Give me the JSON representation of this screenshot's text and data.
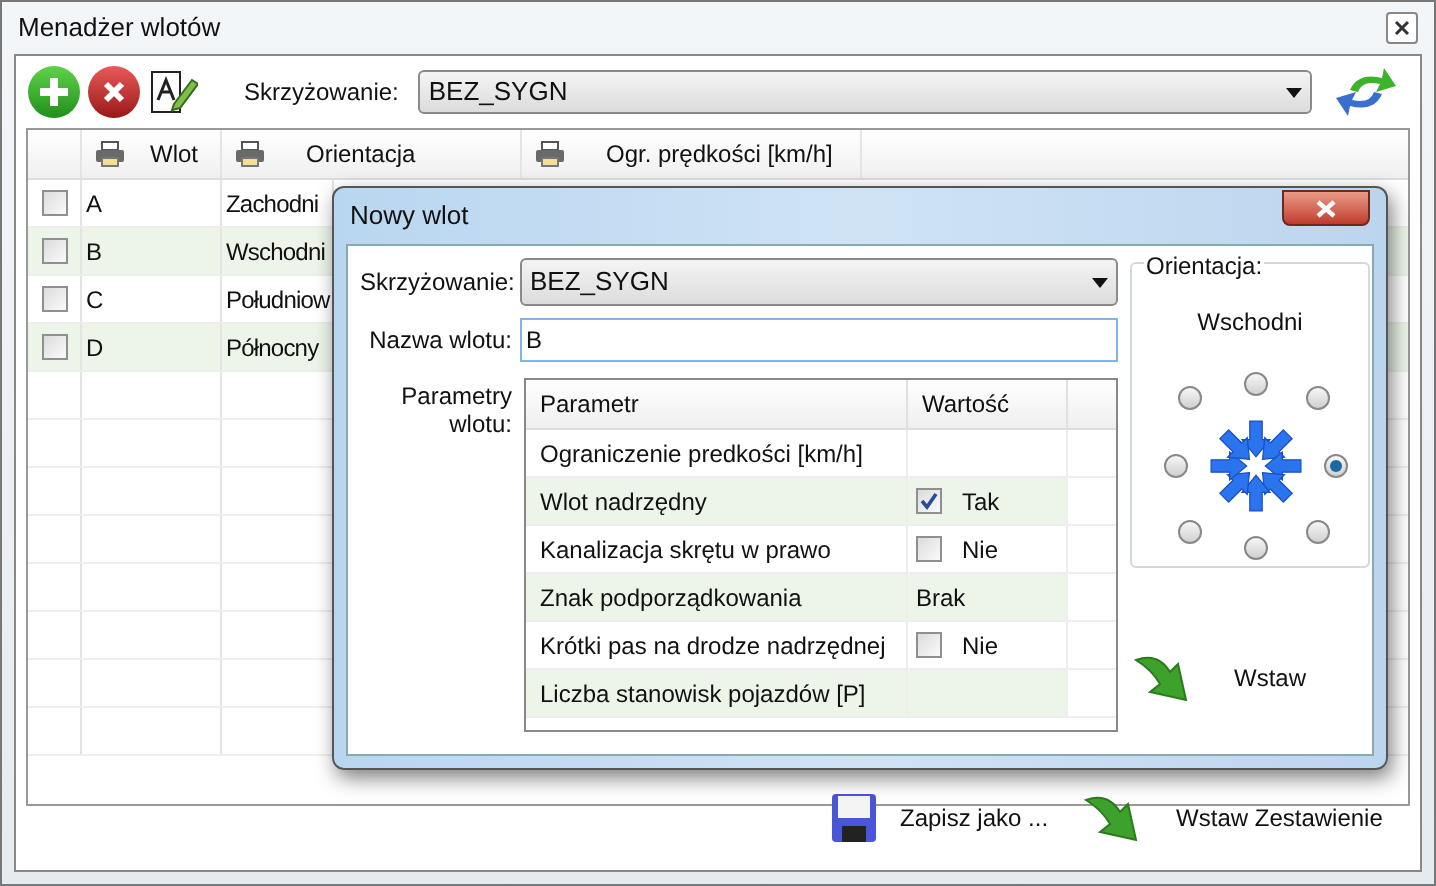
{
  "window": {
    "title": "Menadżer wlotów"
  },
  "toolbar": {
    "intersection_label": "Skrzyżowanie:",
    "intersection_value": "BEZ_SYGN"
  },
  "table": {
    "columns": [
      "Wlot",
      "Orientacja",
      "Ogr. prędkości [km/h]"
    ],
    "rows": [
      {
        "checked": false,
        "cells": [
          "A",
          "Zachodni"
        ]
      },
      {
        "checked": false,
        "cells": [
          "B",
          "Wschodni"
        ]
      },
      {
        "checked": false,
        "cells": [
          "C",
          "Południow"
        ]
      },
      {
        "checked": false,
        "cells": [
          "D",
          "Północny"
        ]
      }
    ]
  },
  "dialog": {
    "title": "Nowy wlot",
    "intersection_label": "Skrzyżowanie:",
    "intersection_value": "BEZ_SYGN",
    "name_label": "Nazwa wlotu:",
    "name_value": "B",
    "params_label": "Parametry wlotu:",
    "params_columns": [
      "Parametr",
      "Wartość"
    ],
    "params": [
      {
        "name": "Ograniczenie predkości [km/h]",
        "kind": "empty"
      },
      {
        "name": "Wlot nadrzędny",
        "kind": "checkbox",
        "checked": true,
        "value": "Tak"
      },
      {
        "name": "Kanalizacja skrętu w prawo",
        "kind": "checkbox",
        "checked": false,
        "value": "Nie"
      },
      {
        "name": "Znak podporządkowania",
        "kind": "text",
        "value": "Brak"
      },
      {
        "name": "Krótki pas na drodze nadrzędnej",
        "kind": "checkbox",
        "checked": false,
        "value": "Nie"
      },
      {
        "name": "Liczba stanowisk pojazdów [P]",
        "kind": "empty"
      }
    ],
    "orientation": {
      "label": "Orientacja:",
      "value": "Wschodni",
      "options": [
        {
          "selected": false
        },
        {
          "selected": false
        },
        {
          "selected": true
        },
        {
          "selected": false
        },
        {
          "selected": false
        },
        {
          "selected": false
        },
        {
          "selected": false
        },
        {
          "selected": false
        }
      ]
    },
    "insert_button": "Wstaw"
  },
  "footer": {
    "save_button": "Zapisz jako ...",
    "insert_button": "Wstaw Zestawienie"
  }
}
